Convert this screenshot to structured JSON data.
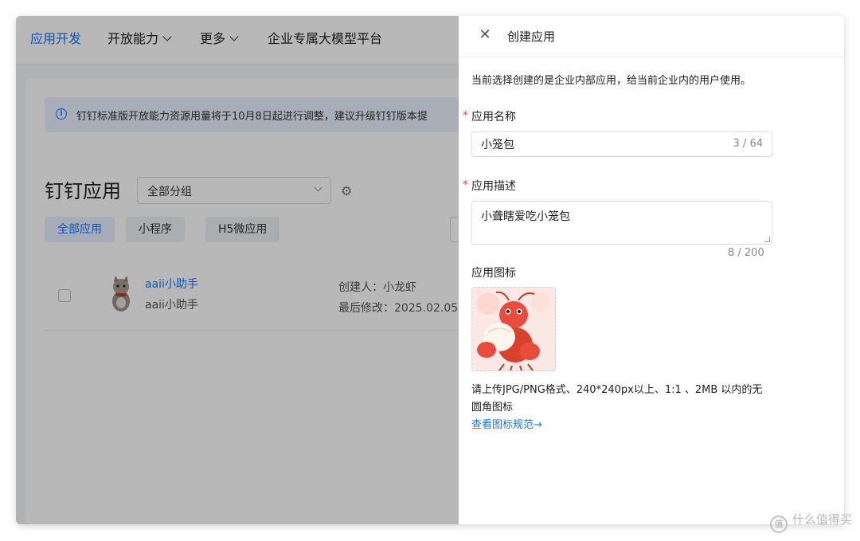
{
  "nav": {
    "items": [
      {
        "label": "应用开发",
        "active": true
      },
      {
        "label": "开放能力",
        "has_dropdown": true
      },
      {
        "label": "更多",
        "has_dropdown": true
      },
      {
        "label": "企业专属大模型平台"
      }
    ]
  },
  "notice": {
    "icon": "info-icon",
    "text": "钉钉标准版开放能力资源用量将于10月8日起进行调整，建议升级钉钉版本提"
  },
  "apps_page": {
    "title": "钉钉应用",
    "group_select": {
      "value": "全部分组"
    },
    "settings_icon": "gear-icon",
    "filter_tabs": [
      {
        "label": "全部应用",
        "active": true
      },
      {
        "label": "小程序"
      },
      {
        "label": "H5微应用"
      }
    ],
    "rows": [
      {
        "name": "aaii小助手",
        "subtitle": "aaii小助手",
        "creator": "创建人：小龙虾",
        "modified": "最后修改：2025.02.05"
      }
    ]
  },
  "drawer": {
    "title": "创建应用",
    "close_icon": "close-icon",
    "intro": "当前选择创建的是企业内部应用，给当前企业内的用户使用。",
    "name_field": {
      "label": "应用名称",
      "required": true,
      "value": "小笼包",
      "counter": "3 / 64"
    },
    "desc_field": {
      "label": "应用描述",
      "required": true,
      "value": "小聋瞎爱吃小笼包",
      "counter": "8 / 200"
    },
    "icon_field": {
      "label": "应用图标",
      "image": "crawfish-eating-bun-illustration"
    },
    "hint": {
      "line1": "请上传JPG/PNG格式、240*240px以上、1:1 、2MB 以内的无",
      "line2": "圆角图标"
    },
    "spec_link": "查看图标规范→"
  },
  "watermark": "什么值得买",
  "colors": {
    "accent": "#1677ff",
    "required": "#e53935",
    "mask": "rgba(0,0,0,0.28)"
  }
}
